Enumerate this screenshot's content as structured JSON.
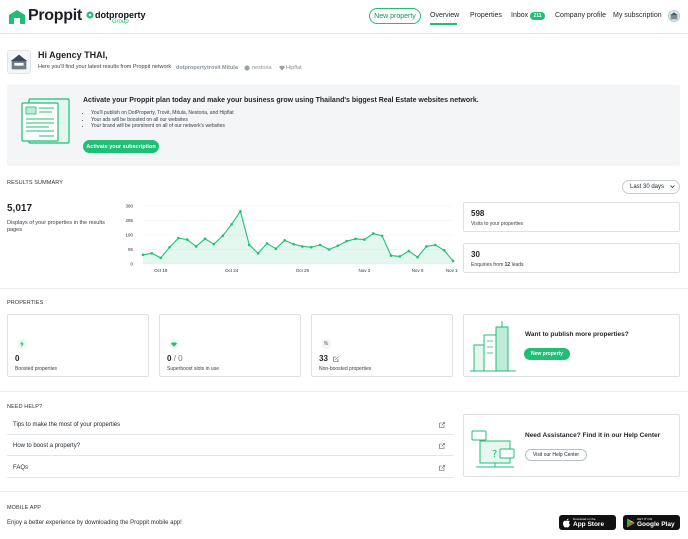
{
  "header": {
    "brand": "Proppit",
    "partner": "dotproperty",
    "partner_sub": "Group",
    "new_property": "New property",
    "nav": {
      "overview": "Overview",
      "properties": "Properties",
      "inbox": "Inbox",
      "company_profile": "Company profile",
      "subscription": "My subscription"
    },
    "inbox_badge": "211"
  },
  "welcome": {
    "title": "Hi Agency THAI,",
    "subtitle": "Here you'll find your latest results from Proppit network",
    "network": [
      "dotproperty",
      "trovit",
      "Mitula",
      "nestoria",
      "Hipflat"
    ]
  },
  "banner": {
    "title": "Activate your Proppit plan today and make your business grow using Thailand's biggest Real Estate websites network.",
    "bullets": [
      "You'll publish on DotProperty, Trovit, Mitula, Nestoria, and Hipflat",
      "Your ads will be boosted on all our websites",
      "Your brand will be prominent on all of our network's websites"
    ],
    "cta": "Activate your subscription"
  },
  "results": {
    "section": "RESULTS SUMMARY",
    "period": "Last 30 days",
    "displays": "5,017",
    "displays_label": "Displays of your properties in the results pages",
    "visits": "598",
    "visits_label": "Visits to your properties",
    "enquiries": "30",
    "enquiries_label_pre": "Enquiries from",
    "leads": "12",
    "enquiries_label_post": "leads"
  },
  "chart_data": {
    "type": "area",
    "y_ticks": [
      "380",
      "285",
      "190",
      "95",
      "0"
    ],
    "ylim": [
      0,
      380
    ],
    "x_ticks": [
      "Oct 19",
      "Oct 24",
      "Oct 29",
      "Nov 3",
      "Nov 8",
      "Nov 16"
    ],
    "values": [
      60,
      70,
      40,
      110,
      170,
      160,
      115,
      165,
      130,
      185,
      260,
      345,
      125,
      70,
      135,
      100,
      155,
      130,
      115,
      110,
      125,
      95,
      120,
      150,
      165,
      160,
      200,
      185,
      55,
      50,
      85,
      45,
      115,
      125,
      90,
      20
    ],
    "color": "#1fbf76"
  },
  "properties": {
    "section": "PROPERTIES",
    "boosted_num": "0",
    "boosted_label": "Boosted properties",
    "superboost_num": "0",
    "superboost_total": "0",
    "superboost_sep": "/",
    "superboost_label": "Superboost slots in use",
    "nonboosted_num": "33",
    "nonboosted_label": "Non-boosted properties",
    "promo_title": "Want to publish more properties?",
    "promo_btn": "New property"
  },
  "help": {
    "section": "NEED HELP?",
    "items": [
      "Tips to make the most of your properties",
      "How to boost a property?",
      "FAQs"
    ],
    "promo_title": "Need Assistance? Find it in our Help Center",
    "promo_btn": "Visit our Help Center"
  },
  "mobile": {
    "section": "MOBILE APP",
    "text": "Enjoy a better experience by downloading the Proppit mobile app!",
    "appstore_small": "Download on the",
    "appstore_big": "App Store",
    "google_small": "GET IT ON",
    "google_big": "Google Play"
  }
}
